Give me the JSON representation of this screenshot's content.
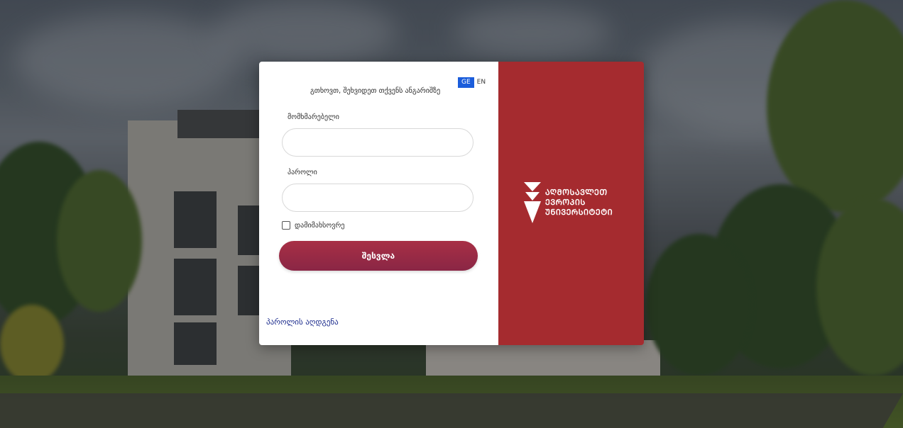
{
  "language": {
    "active": "GE",
    "other": "EN"
  },
  "login": {
    "welcome": "გთხოვთ, შეხვიდეთ თქვენს ანგარიშზე",
    "username_label": "მომხმარებელი",
    "username_value": "",
    "password_label": "პაროლი",
    "password_value": "",
    "remember_label": "დამიმახსოვრე",
    "remember_checked": false,
    "submit_label": "შესვლა",
    "recover_label": "პაროლის აღდგენა"
  },
  "brand": {
    "lines": [
      "ᲐᲦᲛᲝᲡᲐᲕᲚᲔᲗ",
      "ᲔᲕᲠᲝᲞᲘᲡ",
      "ᲣᲜᲘᲕᲔᲠᲡᲘᲢᲔᲢᲘ"
    ],
    "panel_color": "#a52b2f",
    "icon": "stacked-triangles-logo"
  },
  "colors": {
    "accent": "#1b5ddb",
    "button": "#a82f45",
    "link": "#1a2a8c"
  }
}
